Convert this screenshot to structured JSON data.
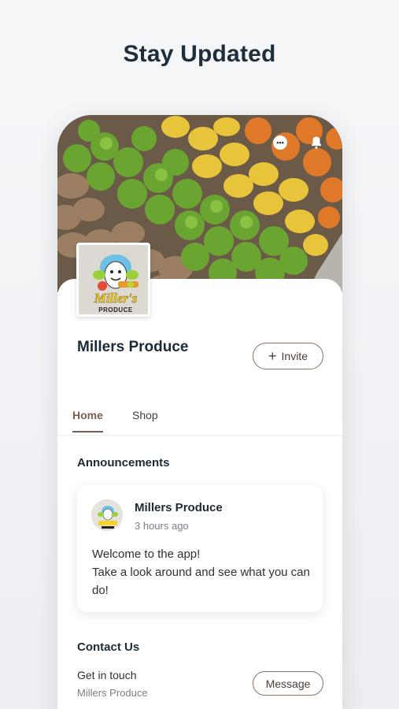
{
  "headline": "Stay Updated",
  "icons": {
    "chat": "chat-bubble-icon",
    "bell": "bell-icon"
  },
  "business": {
    "name": "Millers Produce",
    "logo_text_top": "Miller's",
    "logo_text_bottom": "PRODUCE"
  },
  "actions": {
    "invite_label": "Invite",
    "message_label": "Message"
  },
  "tabs": [
    {
      "label": "Home",
      "active": true
    },
    {
      "label": "Shop",
      "active": false
    }
  ],
  "announcements": {
    "title": "Announcements",
    "post": {
      "author": "Millers Produce",
      "time": "3 hours ago",
      "line1": "Welcome to the app!",
      "line2": "Take a look around and see what you can do!"
    }
  },
  "contact": {
    "title": "Contact Us",
    "label": "Get in touch",
    "sub": "Millers Produce"
  },
  "colors": {
    "accent": "#7a5c50",
    "text": "#1e2a33"
  }
}
